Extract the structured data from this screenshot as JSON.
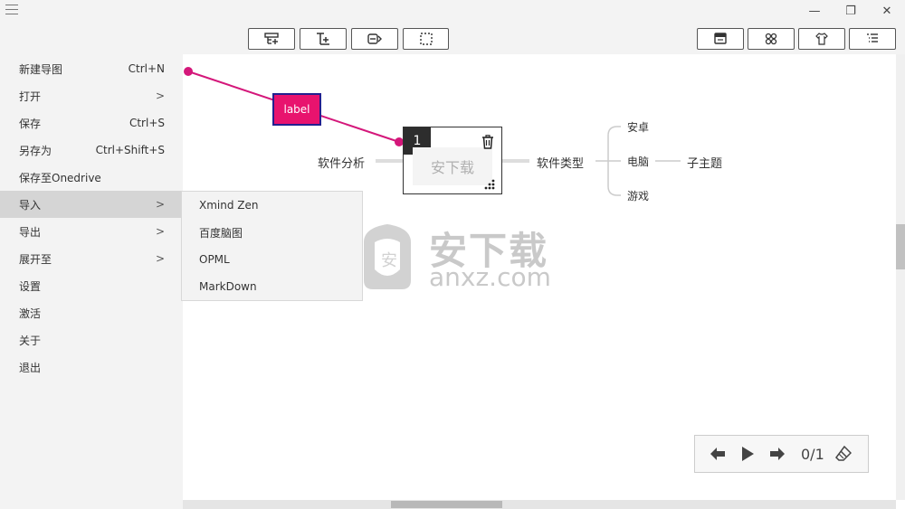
{
  "window": {
    "minimize_glyph": "—",
    "restore_glyph": "❐",
    "close_glyph": "✕"
  },
  "toolbar": {
    "left_icons": [
      "add-subtopic-icon",
      "add-child-topic-icon",
      "add-label-icon",
      "selection-icon"
    ],
    "right_icons": [
      "style-icon",
      "layout-icon",
      "theme-icon",
      "outline-icon"
    ]
  },
  "menu": {
    "items": [
      {
        "label": "新建导图",
        "shortcut": "Ctrl+N",
        "chevron": ""
      },
      {
        "label": "打开",
        "shortcut": "",
        "chevron": ">"
      },
      {
        "label": "保存",
        "shortcut": "Ctrl+S",
        "chevron": ""
      },
      {
        "label": "另存为",
        "shortcut": "Ctrl+Shift+S",
        "chevron": ""
      },
      {
        "label": "保存至Onedrive",
        "shortcut": "",
        "chevron": ""
      },
      {
        "label": "导入",
        "shortcut": "",
        "chevron": ">"
      },
      {
        "label": "导出",
        "shortcut": "",
        "chevron": ">"
      },
      {
        "label": "展开至",
        "shortcut": "",
        "chevron": ">"
      },
      {
        "label": "设置",
        "shortcut": "",
        "chevron": ""
      },
      {
        "label": "激活",
        "shortcut": "",
        "chevron": ""
      },
      {
        "label": "关于",
        "shortcut": "",
        "chevron": ""
      },
      {
        "label": "退出",
        "shortcut": "",
        "chevron": ""
      }
    ],
    "active_index": 5
  },
  "submenu": {
    "items": [
      "Xmind Zen",
      "百度脑图",
      "OPML",
      "MarkDown"
    ]
  },
  "mindmap": {
    "left_topic": "软件分析",
    "central_number": "1",
    "central_text": "安下载",
    "right_topic": "软件类型",
    "children": [
      "安卓",
      "电脑",
      "游戏"
    ],
    "grandchild": "子主题",
    "label_text": "label"
  },
  "watermark": {
    "title": "安下载",
    "subtitle": "anxz.com"
  },
  "player": {
    "page_counter": "0/1"
  },
  "colors": {
    "label_fill": "#e8136e",
    "label_border": "#23208f",
    "connector": "#d4177a"
  }
}
